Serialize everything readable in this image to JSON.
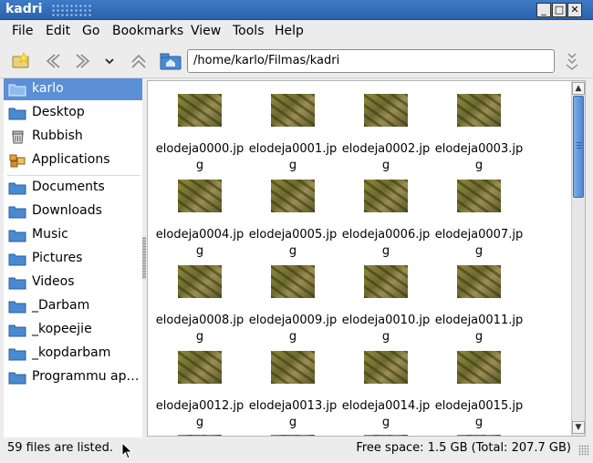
{
  "window": {
    "title": "kadri",
    "min_label": "_",
    "max_label": "□",
    "close_label": "✕"
  },
  "menu": [
    "File",
    "Edit",
    "Go",
    "Bookmarks",
    "View",
    "Tools",
    "Help"
  ],
  "location": {
    "path": "/home/karlo/Filmas/kadri"
  },
  "sidebar": {
    "places": [
      {
        "label": "karlo",
        "icon": "folder-home-icon",
        "selected": true
      },
      {
        "label": "Desktop",
        "icon": "folder-icon"
      },
      {
        "label": "Rubbish",
        "icon": "trash-icon"
      },
      {
        "label": "Applications",
        "icon": "applications-icon"
      }
    ],
    "bookmarks": [
      {
        "label": "Documents",
        "icon": "folder-icon"
      },
      {
        "label": "Downloads",
        "icon": "folder-icon"
      },
      {
        "label": "Music",
        "icon": "folder-icon"
      },
      {
        "label": "Pictures",
        "icon": "folder-icon"
      },
      {
        "label": "Videos",
        "icon": "folder-icon"
      },
      {
        "label": "_Darbam",
        "icon": "folder-icon"
      },
      {
        "label": "_kopeejie",
        "icon": "folder-icon"
      },
      {
        "label": "_kopdarbam",
        "icon": "folder-icon"
      },
      {
        "label": "Programmu ap…",
        "icon": "folder-icon"
      }
    ]
  },
  "files": [
    "elodeja0000.jpg",
    "elodeja0001.jpg",
    "elodeja0002.jpg",
    "elodeja0003.jpg",
    "elodeja0004.jpg",
    "elodeja0005.jpg",
    "elodeja0006.jpg",
    "elodeja0007.jpg",
    "elodeja0008.jpg",
    "elodeja0009.jpg",
    "elodeja0010.jpg",
    "elodeja0011.jpg",
    "elodeja0012.jpg",
    "elodeja0013.jpg",
    "elodeja0014.jpg",
    "elodeja0015.jpg"
  ],
  "status": {
    "count": "59 files are listed.",
    "free_space": "Free space: 1.5 GB (Total: 207.7 GB)"
  },
  "colors": {
    "titlebar": "#2f6db8",
    "selection": "#5b8fd6",
    "folder": "#3f82c9"
  }
}
